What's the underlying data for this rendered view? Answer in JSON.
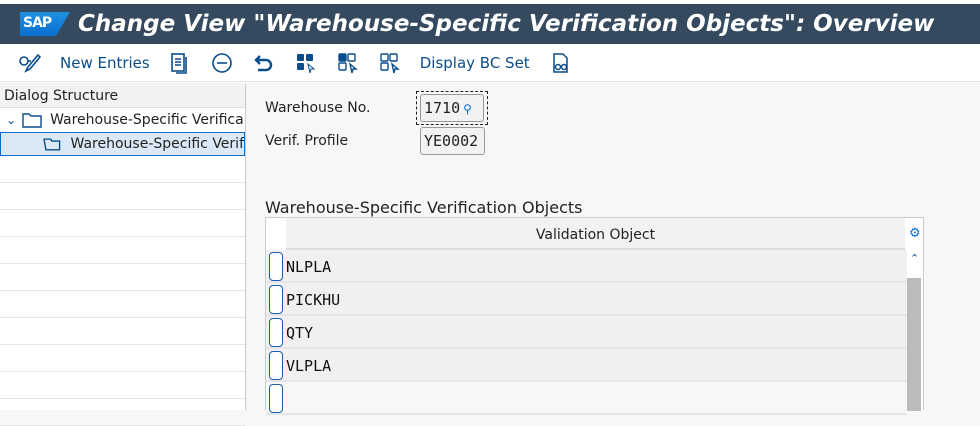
{
  "header": {
    "logo": "SAP",
    "title": "Change View \"Warehouse-Specific Verification Objects\": Overview"
  },
  "toolbar": {
    "new_entries": "New Entries",
    "display_bc_set": "Display BC Set"
  },
  "dialog": {
    "header": "Dialog Structure",
    "nodes": [
      "Warehouse-Specific Verifica",
      "Warehouse-Specific Verif"
    ]
  },
  "form": {
    "warehouse_label": "Warehouse No.",
    "warehouse_value": "1710",
    "profile_label": "Verif. Profile",
    "profile_value": "YE0002"
  },
  "table": {
    "title": "Warehouse-Specific Verification Objects",
    "column": "Validation Object",
    "rows": [
      "NLPLA",
      "PICKHU",
      "QTY",
      "VLPLA",
      ""
    ]
  }
}
